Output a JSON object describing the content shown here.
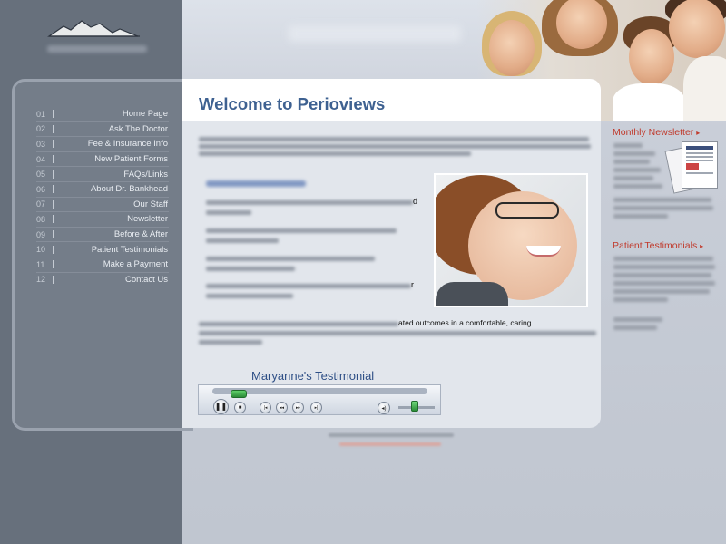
{
  "content": {
    "title": "Welcome to Perioviews",
    "testimonial_title": "Maryanne's Testimonial",
    "partial_text": [
      "d",
      "r",
      "ated outcomes in a comfortable, caring"
    ]
  },
  "nav": {
    "items": [
      {
        "num": "01",
        "label": "Home Page"
      },
      {
        "num": "02",
        "label": "Ask The Doctor"
      },
      {
        "num": "03",
        "label": "Fee & Insurance Info"
      },
      {
        "num": "04",
        "label": "New Patient Forms"
      },
      {
        "num": "05",
        "label": "FAQs/Links"
      },
      {
        "num": "06",
        "label": "About Dr. Bankhead"
      },
      {
        "num": "07",
        "label": "Our Staff"
      },
      {
        "num": "08",
        "label": "Newsletter"
      },
      {
        "num": "09",
        "label": "Before & After"
      },
      {
        "num": "10",
        "label": "Patient Testimonials"
      },
      {
        "num": "11",
        "label": "Make a Payment"
      },
      {
        "num": "12",
        "label": "Contact Us"
      }
    ]
  },
  "sidebar": {
    "newsletter_title": "Monthly Newsletter",
    "testimonials_title": "Patient Testimonials",
    "arrow": "▸"
  },
  "player": {
    "pause": "❚❚",
    "stop": "■",
    "prev": "|◂",
    "rewind": "◂◂",
    "forward": "▸▸",
    "next": "▸|",
    "mute": "◂)"
  },
  "colors": {
    "accent": "#3e6191",
    "link_red": "#c0392b",
    "sidebar_bg": "#67707c"
  },
  "icons": [
    "mountain-logo-icon",
    "pause-icon",
    "stop-icon",
    "previous-icon",
    "rewind-icon",
    "fast-forward-icon",
    "next-icon",
    "volume-icon",
    "arrow-right-icon"
  ]
}
